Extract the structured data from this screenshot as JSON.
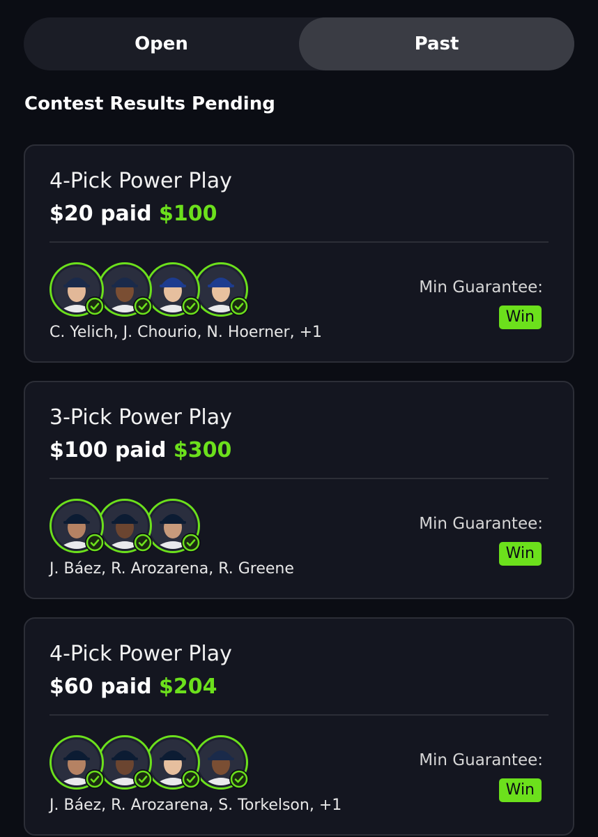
{
  "tabs": [
    {
      "label": "Open",
      "active": false
    },
    {
      "label": "Past",
      "active": true
    }
  ],
  "section_title": "Contest Results Pending",
  "colors": {
    "accent_green": "#6ce01c",
    "background": "#0b0d14",
    "card": "#141620",
    "active_tab": "#3a3c44"
  },
  "cards": [
    {
      "title": "4-Pick Power Play",
      "stake": "$20 paid",
      "payout": "$100",
      "players_text": "C. Yelich, J. Chourio, N. Hoerner, +1",
      "guarantee_label": "Min Guarantee:",
      "result": "Win",
      "avatars": [
        {
          "icon": "player-photo-icon",
          "cap": "#1a2a4a",
          "skin": "#e2b898"
        },
        {
          "icon": "player-photo-icon",
          "cap": "#1a2a4a",
          "skin": "#7a4e33"
        },
        {
          "icon": "player-photo-icon",
          "cap": "#1d3c8f",
          "skin": "#e6bf9e"
        },
        {
          "icon": "player-photo-icon",
          "cap": "#1d3c8f",
          "skin": "#e8c19f"
        }
      ]
    },
    {
      "title": "3-Pick Power Play",
      "stake": "$100 paid",
      "payout": "$300",
      "players_text": "J. Báez, R. Arozarena, R. Greene",
      "guarantee_label": "Min Guarantee:",
      "result": "Win",
      "avatars": [
        {
          "icon": "player-photo-icon",
          "cap": "#0c1c33",
          "skin": "#b58263"
        },
        {
          "icon": "player-photo-icon",
          "cap": "#0c1c33",
          "skin": "#6b4530"
        },
        {
          "icon": "player-photo-icon",
          "cap": "#0c1c33",
          "skin": "#c79a7c"
        }
      ]
    },
    {
      "title": "4-Pick Power Play",
      "stake": "$60 paid",
      "payout": "$204",
      "players_text": "J. Báez, R. Arozarena, S. Torkelson, +1",
      "guarantee_label": "Min Guarantee:",
      "result": "Win",
      "avatars": [
        {
          "icon": "player-photo-icon",
          "cap": "#0c1c33",
          "skin": "#b58263"
        },
        {
          "icon": "player-photo-icon",
          "cap": "#0c1c33",
          "skin": "#6b4530"
        },
        {
          "icon": "player-photo-icon",
          "cap": "#0c1c33",
          "skin": "#e6bf9e"
        },
        {
          "icon": "player-photo-icon",
          "cap": "#1a2a4a",
          "skin": "#7a4e33"
        }
      ]
    }
  ]
}
